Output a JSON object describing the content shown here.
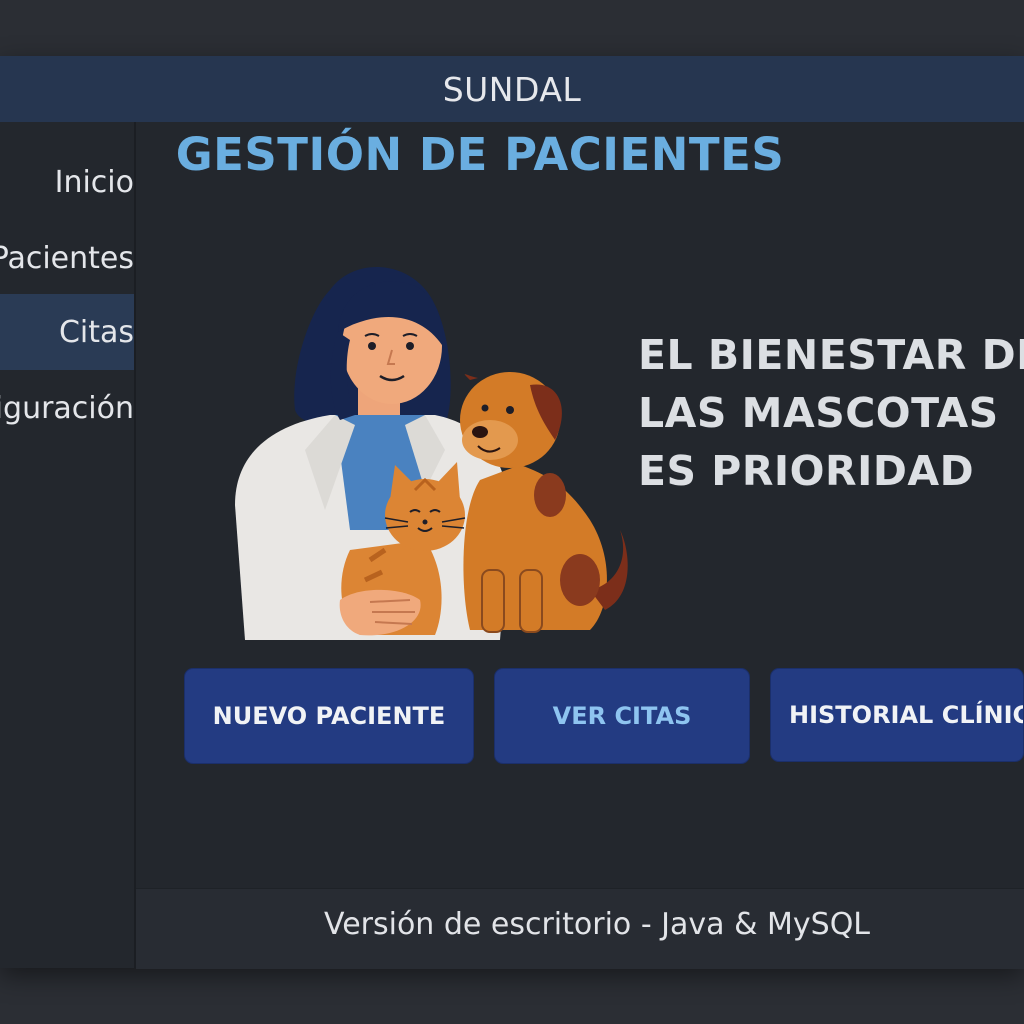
{
  "app": {
    "title": "SUNDAL"
  },
  "sidebar": {
    "items": [
      {
        "label": "Inicio",
        "active": false
      },
      {
        "label": "Pacientes",
        "active": false
      },
      {
        "label": "Citas",
        "active": true
      },
      {
        "label": "Configuración",
        "active": false
      }
    ]
  },
  "main": {
    "title": "GESTIÓN DE PACIENTES",
    "slogan_lines": [
      "EL BIENESTAR DE",
      "LAS MASCOTAS",
      "ES PRIORIDAD"
    ],
    "buttons": {
      "new_patient": "NUEVO PACIENTE",
      "view_appointments": "VER CITAS",
      "clinical_history": "HISTORIAL CLÍNICO"
    }
  },
  "footer": {
    "text": "Versión de escritorio - Java & MySQL"
  },
  "colors": {
    "accent": "#6aaee0",
    "titlebar": "#263650",
    "button": "#233b82",
    "active_nav": "#2a3b55",
    "background": "#23272d"
  },
  "icons": {
    "illustration": "veterinarian-with-cat-and-dog"
  }
}
